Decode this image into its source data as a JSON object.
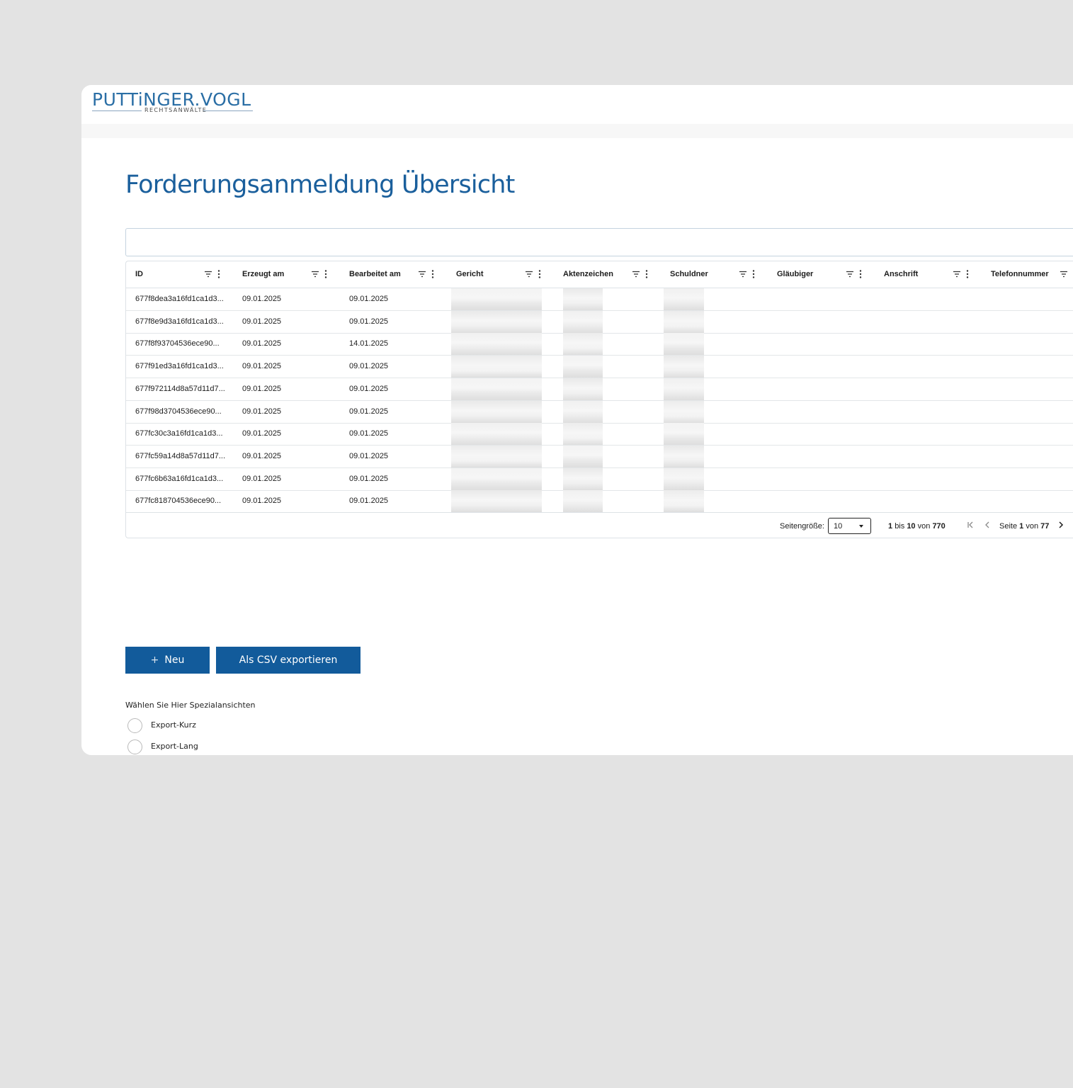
{
  "brand": {
    "name": "PUTTiNGER.VOGL",
    "subtitle": "RECHTSANWÄLTE",
    "color": "#2a6ea5"
  },
  "page": {
    "title": "Forderungsanmeldung Übersicht"
  },
  "grid": {
    "columns": [
      "ID",
      "Erzeugt am",
      "Bearbeitet am",
      "Gericht",
      "Aktenzeichen",
      "Schuldner",
      "Gläubiger",
      "Anschrift",
      "Telefonnummer"
    ],
    "rows": [
      {
        "id": "677f8dea3a16fd1ca1d3...",
        "created": "09.01.2025",
        "edited": "09.01.2025"
      },
      {
        "id": "677f8e9d3a16fd1ca1d3...",
        "created": "09.01.2025",
        "edited": "09.01.2025"
      },
      {
        "id": "677f8f93704536ece90...",
        "created": "09.01.2025",
        "edited": "14.01.2025"
      },
      {
        "id": "677f91ed3a16fd1ca1d3...",
        "created": "09.01.2025",
        "edited": "09.01.2025"
      },
      {
        "id": "677f972114d8a57d11d7...",
        "created": "09.01.2025",
        "edited": "09.01.2025"
      },
      {
        "id": "677f98d3704536ece90...",
        "created": "09.01.2025",
        "edited": "09.01.2025"
      },
      {
        "id": "677fc30c3a16fd1ca1d3...",
        "created": "09.01.2025",
        "edited": "09.01.2025"
      },
      {
        "id": "677fc59a14d8a57d11d7...",
        "created": "09.01.2025",
        "edited": "09.01.2025"
      },
      {
        "id": "677fc6b63a16fd1ca1d3...",
        "created": "09.01.2025",
        "edited": "09.01.2025"
      },
      {
        "id": "677fc818704536ece90...",
        "created": "09.01.2025",
        "edited": "09.01.2025"
      }
    ]
  },
  "pager": {
    "page_size_label": "Seitengröße:",
    "page_size": "10",
    "range_from": "1",
    "range_to_word": "bis",
    "range_to": "10",
    "range_of_word": "von",
    "total": "770",
    "page_word": "Seite",
    "page": "1",
    "page_of_word": "von",
    "pages": "77"
  },
  "actions": {
    "new_label": "Neu",
    "csv_label": "Als CSV exportieren",
    "accent": "#125b9b"
  },
  "special_views": {
    "label": "Wählen Sie Hier Spezialansichten",
    "options": [
      "Export-Kurz",
      "Export-Lang"
    ]
  },
  "icons": [
    "filter-icon",
    "column-menu-icon",
    "first-page-icon",
    "previous-page-icon",
    "next-page-icon",
    "plus-icon",
    "caret-down-icon"
  ]
}
